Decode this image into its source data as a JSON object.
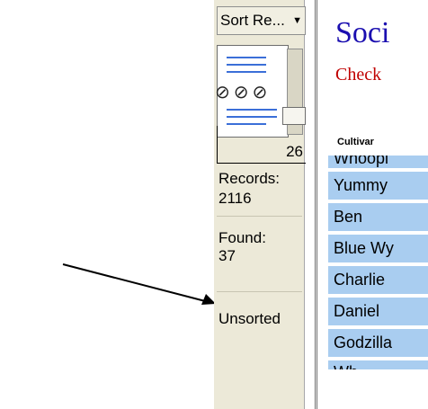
{
  "sidebar": {
    "sort_menu_label": "Sort Re...",
    "record_number": "26",
    "records_label": "Records:",
    "records_value": "2116",
    "found_label": "Found:",
    "found_value": "37",
    "sort_status": "Unsorted"
  },
  "main": {
    "title": "Soci",
    "subtitle": "Check",
    "column_header": "Cultivar",
    "rows": [
      "Whoopi",
      "Yummy",
      "Ben",
      "Blue Wy",
      "Charlie",
      "Daniel",
      "Godzilla",
      "Wh"
    ]
  },
  "colors": {
    "panel_bg": "#ece9d8",
    "row_bg": "#a9cdf0",
    "title_color": "#1b0fb0",
    "subtitle_color": "#c00000"
  }
}
